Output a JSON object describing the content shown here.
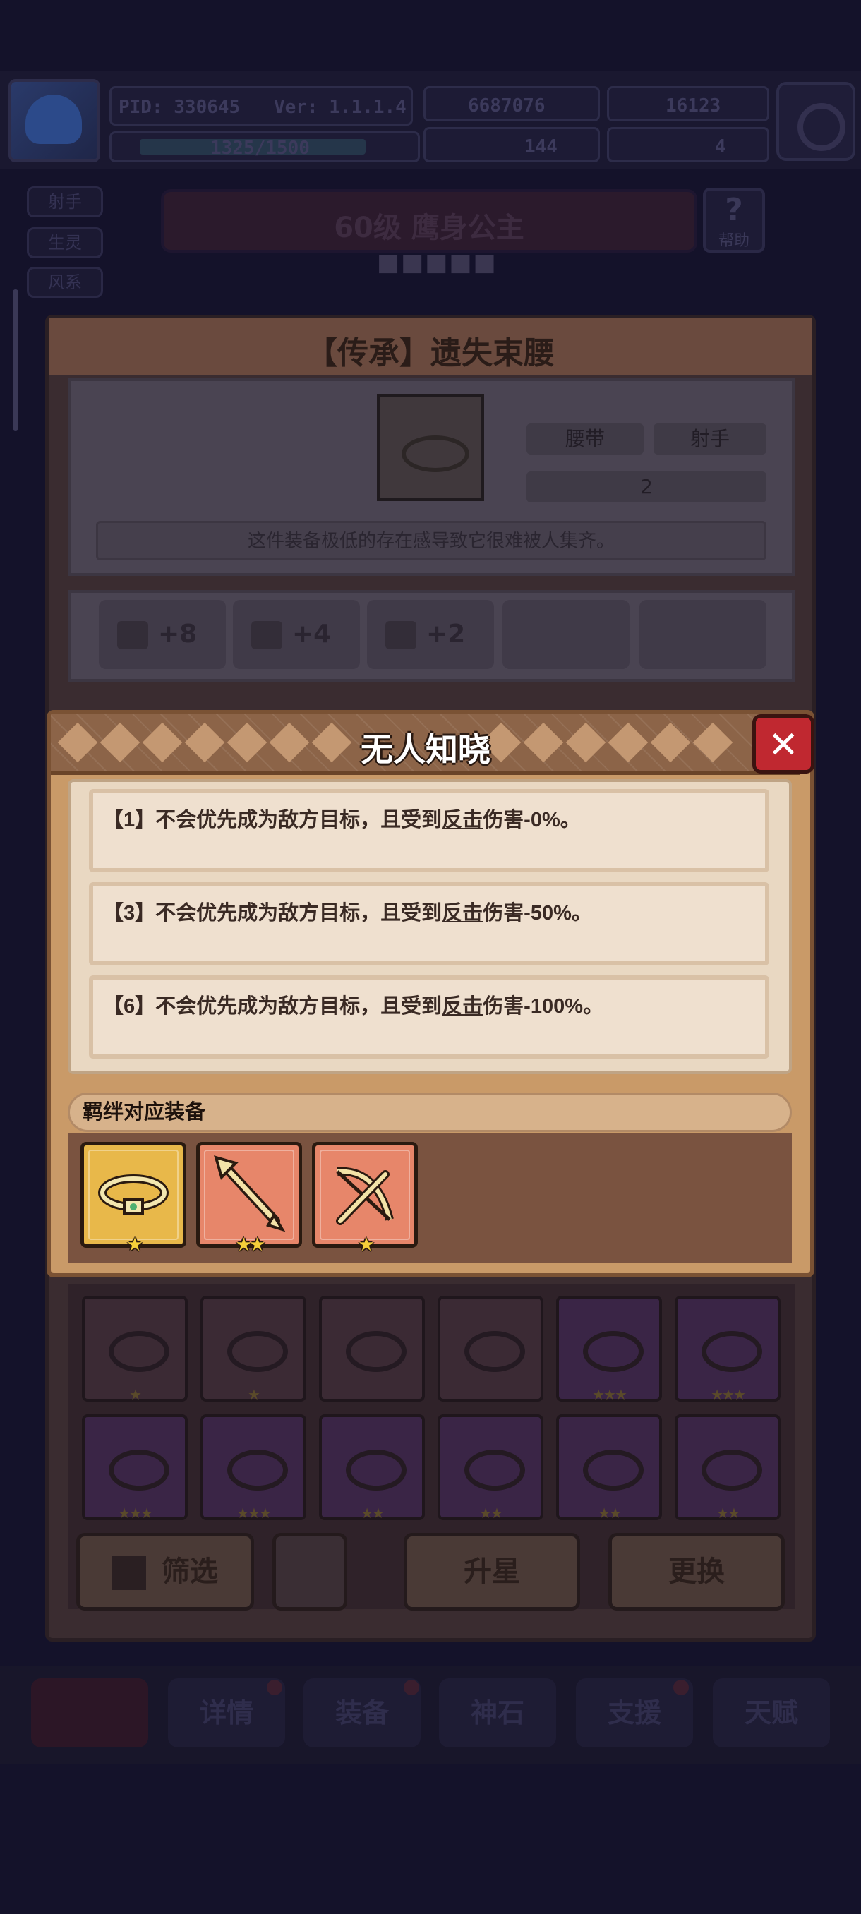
{
  "header": {
    "pid": "PID: 330645",
    "version": "Ver: 1.1.1.4",
    "xp": "1325/1500",
    "gold": "6687076",
    "gems": "16123",
    "clover": "144",
    "keys": "4"
  },
  "side_tags": [
    "射手",
    "生灵",
    "风系"
  ],
  "hero": {
    "title": "60级 鹰身公主",
    "help_label": "帮助"
  },
  "item": {
    "title": "【传承】遗失束腰",
    "type_tag": "腰带",
    "class_tag": "射手",
    "count": "2",
    "description": "这件装备极低的存在感导致它很难被人集齐。",
    "stats": [
      "+8",
      "+4",
      "+2"
    ]
  },
  "modal": {
    "title": "无人知晓",
    "close_icon": "close-icon",
    "effects": [
      {
        "prefix": "【1】不会优先成为敌方目标，且受到",
        "keyword": "反击",
        "suffix": "伤害-0%。"
      },
      {
        "prefix": "【3】不会优先成为敌方目标，且受到",
        "keyword": "反击",
        "suffix": "伤害-50%。"
      },
      {
        "prefix": "【6】不会优先成为敌方目标，且受到",
        "keyword": "反击",
        "suffix": "伤害-100%。"
      }
    ],
    "bond_label": "羁绊对应装备",
    "bond_items": [
      {
        "icon": "belt-icon",
        "stars": "★",
        "frame": "gold"
      },
      {
        "icon": "arrow-icon",
        "stars": "★★",
        "frame": "orange"
      },
      {
        "icon": "crossbow-icon",
        "stars": "★",
        "frame": "orange"
      }
    ]
  },
  "grid": {
    "row1_stars": [
      "★",
      "★",
      "",
      "",
      "★★★",
      "★★★"
    ],
    "row2_stars": [
      "★★★",
      "★★★",
      "★★",
      "★★",
      "★★",
      "★★"
    ]
  },
  "buttons": {
    "filter": "筛选",
    "upgrade": "升星",
    "replace": "更换"
  },
  "tabs": [
    "详情",
    "装备",
    "神石",
    "支援",
    "天赋"
  ],
  "colors": {
    "close_red": "#c02830",
    "panel_tan": "#c99a68",
    "effect_bg": "#efe0cf",
    "star_gold": "#f5cf3a"
  }
}
